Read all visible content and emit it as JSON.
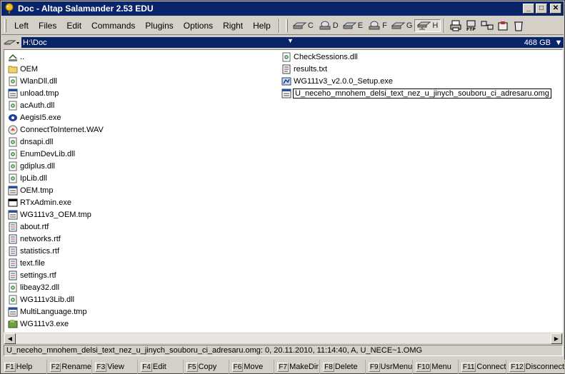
{
  "window": {
    "title": "Doc - Altap Salamander 2.53 EDU"
  },
  "menu": [
    "Left",
    "Files",
    "Edit",
    "Commands",
    "Plugins",
    "Options",
    "Right",
    "Help"
  ],
  "drives": [
    {
      "letter": "C",
      "icon": "hdd-icon"
    },
    {
      "letter": "D",
      "icon": "cdrom-icon"
    },
    {
      "letter": "E",
      "icon": "hdd-icon"
    },
    {
      "letter": "F",
      "icon": "cdrom-icon"
    },
    {
      "letter": "G",
      "icon": "hdd-icon"
    },
    {
      "letter": "H",
      "icon": "network-drive-icon",
      "active": true
    }
  ],
  "path": {
    "value": "H:\\Doc",
    "free_space": "468 GB"
  },
  "files_left": [
    {
      "name": "..",
      "icon": "up-dir-icon"
    },
    {
      "name": "OEM",
      "icon": "folder-icon"
    },
    {
      "name": "WlanDll.dll",
      "icon": "dll-icon"
    },
    {
      "name": "unload.tmp",
      "icon": "generic-file-icon"
    },
    {
      "name": "acAuth.dll",
      "icon": "dll-icon"
    },
    {
      "name": "AegisI5.exe",
      "icon": "exe-icon"
    },
    {
      "name": "ConnectToInternet.WAV",
      "icon": "audio-icon"
    },
    {
      "name": "dnsapi.dll",
      "icon": "dll-icon"
    },
    {
      "name": "EnumDevLib.dll",
      "icon": "dll-icon"
    },
    {
      "name": "gdiplus.dll",
      "icon": "dll-icon"
    },
    {
      "name": "IpLib.dll",
      "icon": "dll-icon"
    },
    {
      "name": "OEM.tmp",
      "icon": "generic-file-icon"
    },
    {
      "name": "RTxAdmin.exe",
      "icon": "app-window-icon"
    },
    {
      "name": "WG111v3_OEM.tmp",
      "icon": "generic-file-icon"
    },
    {
      "name": "about.rtf",
      "icon": "doc-icon"
    },
    {
      "name": "networks.rtf",
      "icon": "doc-icon"
    },
    {
      "name": "statistics.rtf",
      "icon": "doc-icon"
    },
    {
      "name": "text.file",
      "icon": "doc-icon"
    },
    {
      "name": "settings.rtf",
      "icon": "doc-icon"
    },
    {
      "name": "libeay32.dll",
      "icon": "dll-icon"
    },
    {
      "name": "WG111v3Lib.dll",
      "icon": "dll-icon"
    },
    {
      "name": "MultiLanguage.tmp",
      "icon": "generic-file-icon"
    },
    {
      "name": "WG111v3.exe",
      "icon": "app-green-icon"
    }
  ],
  "files_right": [
    {
      "name": "CheckSessions.dll",
      "icon": "dll-icon"
    },
    {
      "name": "results.txt",
      "icon": "text-icon"
    },
    {
      "name": "WG111v3_v2.0.0_Setup.exe",
      "icon": "setup-icon"
    },
    {
      "name": "U_neceho_mnohem_delsi_text_nez_u_jinych_souboru_ci_adresaru.omg",
      "icon": "generic-file-icon",
      "focused": true
    }
  ],
  "info_line": "U_neceho_mnohem_delsi_text_nez_u_jinych_souboru_ci_adresaru.omg: 0, 20.11.2010, 11:14:40, A, U_NECE~1.OMG",
  "fkeys": [
    {
      "key": "F1",
      "label": "Help"
    },
    {
      "key": "F2",
      "label": "Rename"
    },
    {
      "key": "F3",
      "label": "View"
    },
    {
      "key": "F4",
      "label": "Edit"
    },
    {
      "key": "F5",
      "label": "Copy"
    },
    {
      "key": "F6",
      "label": "Move"
    },
    {
      "key": "F7",
      "label": "MakeDir"
    },
    {
      "key": "F8",
      "label": "Delete"
    },
    {
      "key": "F9",
      "label": "UsrMenu"
    },
    {
      "key": "F10",
      "label": "Menu"
    },
    {
      "key": "F11",
      "label": "Connect"
    },
    {
      "key": "F12",
      "label": "Disconnect"
    }
  ],
  "colors": {
    "titlebar": "#0a246a",
    "face": "#d4d0c8",
    "panel": "#ffffff"
  }
}
